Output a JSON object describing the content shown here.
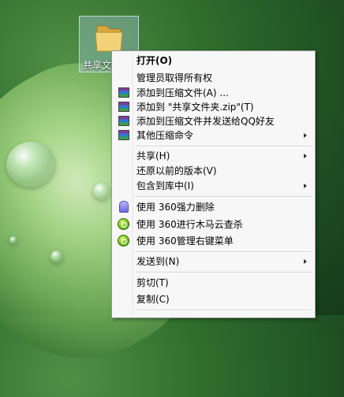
{
  "desktop": {
    "folder_label": "共享文件夹",
    "folder_icon": "folder-icon"
  },
  "context_menu": {
    "open": "打开(O)",
    "take_ownership": "管理员取得所有权",
    "add_to_archive": "添加到压缩文件(A) ...",
    "add_to_zip": "添加到 \"共享文件夹.zip\"(T)",
    "add_and_send_qq": "添加到压缩文件并发送给QQ好友",
    "other_compress": "其他压缩命令",
    "share": "共享(H)",
    "restore_previous": "还原以前的版本(V)",
    "include_in_library": "包含到库中(I)",
    "force_delete_360": "使用 360强力删除",
    "trojan_scan_360": "使用 360进行木马云查杀",
    "manage_menu_360": "使用 360管理右键菜单",
    "send_to": "发送到(N)",
    "cut": "剪切(T)",
    "copy": "复制(C)"
  },
  "colors": {
    "menu_background": "#f7f7f7",
    "menu_border": "#9a9a9a"
  }
}
